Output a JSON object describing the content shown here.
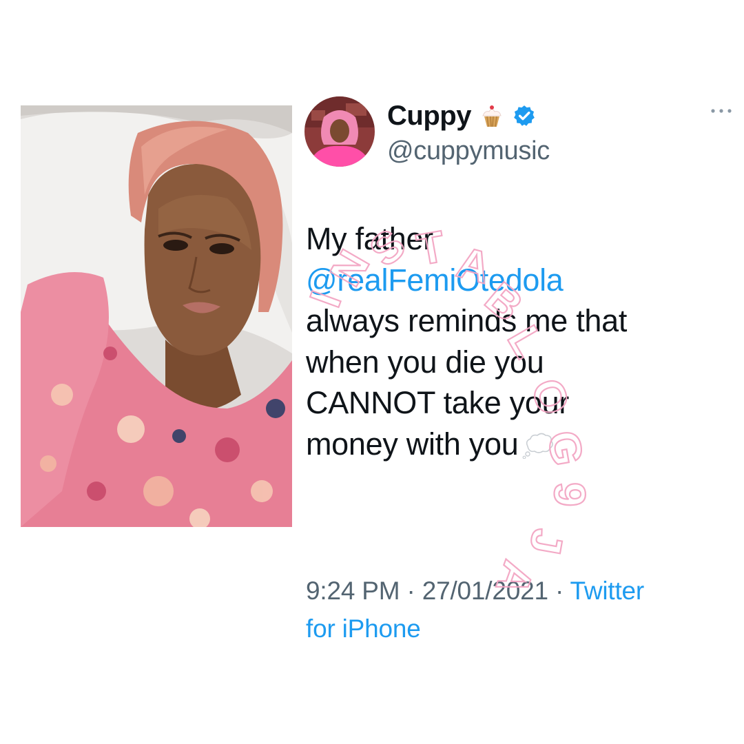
{
  "tweet": {
    "display_name": "Cuppy",
    "name_emoji": "cupcake-icon",
    "verified": "verified-badge-icon",
    "handle": "@cuppymusic",
    "more": "more-options-icon",
    "text": {
      "line1": "My father",
      "mention": "@realFemiOtedola",
      "line3": "always reminds me that",
      "line4": "when you die you",
      "line5": "CANNOT take your",
      "line6": "money with you",
      "trailing_emoji": "thought-balloon-icon"
    },
    "meta": {
      "time": "9:24 PM",
      "separator": " · ",
      "date": "27/01/2021",
      "source_part1": "Twitter",
      "source_part2": "for iPhone"
    }
  },
  "watermark": {
    "text": "INSTABLOG9JA"
  },
  "colors": {
    "text": "#0f1419",
    "secondary": "#536471",
    "link": "#1d9bf0",
    "watermark": "#f3a6c4",
    "background": "#ffffff"
  }
}
